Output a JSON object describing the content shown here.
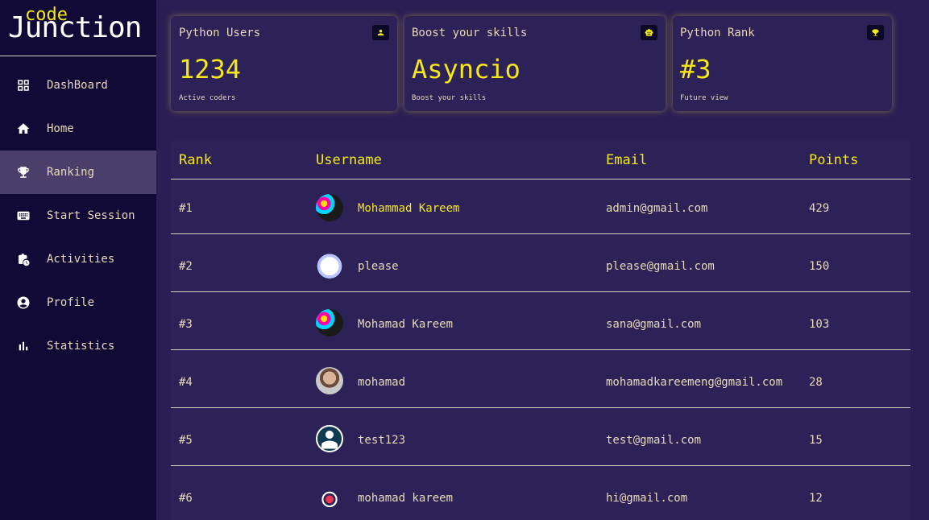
{
  "logo": {
    "small": "code",
    "big": "Junction"
  },
  "nav": [
    {
      "label": "DashBoard",
      "icon": "grid-icon"
    },
    {
      "label": "Home",
      "icon": "home-icon"
    },
    {
      "label": "Ranking",
      "icon": "trophy-icon",
      "active": true
    },
    {
      "label": "Start Session",
      "icon": "keyboard-icon"
    },
    {
      "label": "Activities",
      "icon": "briefcase-clock-icon"
    },
    {
      "label": "Profile",
      "icon": "account-circle-icon"
    },
    {
      "label": "Statistics",
      "icon": "bar-chart-icon"
    }
  ],
  "cards": [
    {
      "title": "Python Users",
      "value": "1234",
      "sub": "Active coders",
      "icon": "user-icon"
    },
    {
      "title": "Boost your skills",
      "value": "Asyncio",
      "sub": "Boost your skills",
      "icon": "robot-icon"
    },
    {
      "title": "Python Rank",
      "value": "#3",
      "sub": "Future view",
      "icon": "trophy-icon"
    }
  ],
  "table": {
    "headers": {
      "rank": "Rank",
      "username": "Username",
      "email": "Email",
      "points": "Points"
    },
    "rows": [
      {
        "rank": "#1",
        "username": "Mohammad Kareem",
        "email": "admin@gmail.com",
        "points": "429",
        "highlight": true,
        "avatar": "colorful-avatar"
      },
      {
        "rank": "#2",
        "username": "please",
        "email": "please@gmail.com",
        "points": "150",
        "avatar": "robot-avatar"
      },
      {
        "rank": "#3",
        "username": "Mohamad Kareem",
        "email": "sana@gmail.com",
        "points": "103",
        "avatar": "colorful-avatar"
      },
      {
        "rank": "#4",
        "username": "mohamad",
        "email": "mohamadkareemeng@gmail.com",
        "points": "28",
        "avatar": "photo-avatar"
      },
      {
        "rank": "#5",
        "username": "test123",
        "email": "test@gmail.com",
        "points": "15",
        "avatar": "default-avatar"
      },
      {
        "rank": "#6",
        "username": "mohamad kareem",
        "email": "hi@gmail.com",
        "points": "12",
        "avatar": "robot-small-avatar"
      }
    ]
  },
  "colors": {
    "accent": "#f5e71a",
    "bg": "#2a1f55",
    "sidebar": "#110a36",
    "text": "#e8d9b8"
  }
}
